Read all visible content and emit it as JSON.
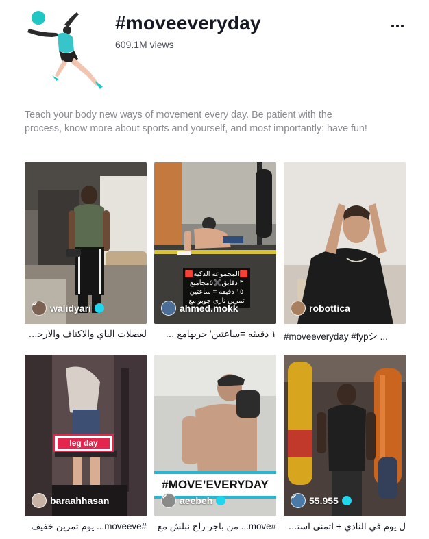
{
  "header": {
    "title": "#moveeveryday",
    "views": "609.1M views",
    "more_icon": "more-horizontal-icon"
  },
  "description": "Teach your body new ways of movement every day. Be patient with the process, know more about sports and yourself, and most importantly: have fun!",
  "colors": {
    "verified": "#20d5ec",
    "text": "#161823",
    "muted": "#8a8b91",
    "accent_red": "#e4264e",
    "accent_cyan": "#25b7d3"
  },
  "videos": [
    {
      "username": "walidyari",
      "verified": true,
      "caption": "لعضلات الباي والاكتاف والارجل ..."
    },
    {
      "username": "ahmed.mokk",
      "verified": false,
      "caption": "١ دقيقه =ساعتين' جربهامع 🧰 ...",
      "overlay_lines": [
        "🟥المجموعه الذكيه🟥",
        "٣ دقايق✖️٥مجاميع",
        "١٥ دقيقه = ساعتين",
        "تمرين نارى جوبو مع"
      ]
    },
    {
      "username": "robottica",
      "verified": false,
      "caption": "#moveeveryday #fypシ ..."
    },
    {
      "username": "baraahhasan",
      "verified": false,
      "caption": "#moveeve... يوم تمرين خفيف",
      "sticker": "leg day"
    },
    {
      "username": "aeebeh",
      "verified": true,
      "caption": "#move... من باجر راح نبلش مع",
      "banner": "#MOVE’EVERYDAY"
    },
    {
      "username": "55.955",
      "verified": true,
      "caption": "ل يوم في النادي + اتمنى استفدت ..."
    }
  ]
}
